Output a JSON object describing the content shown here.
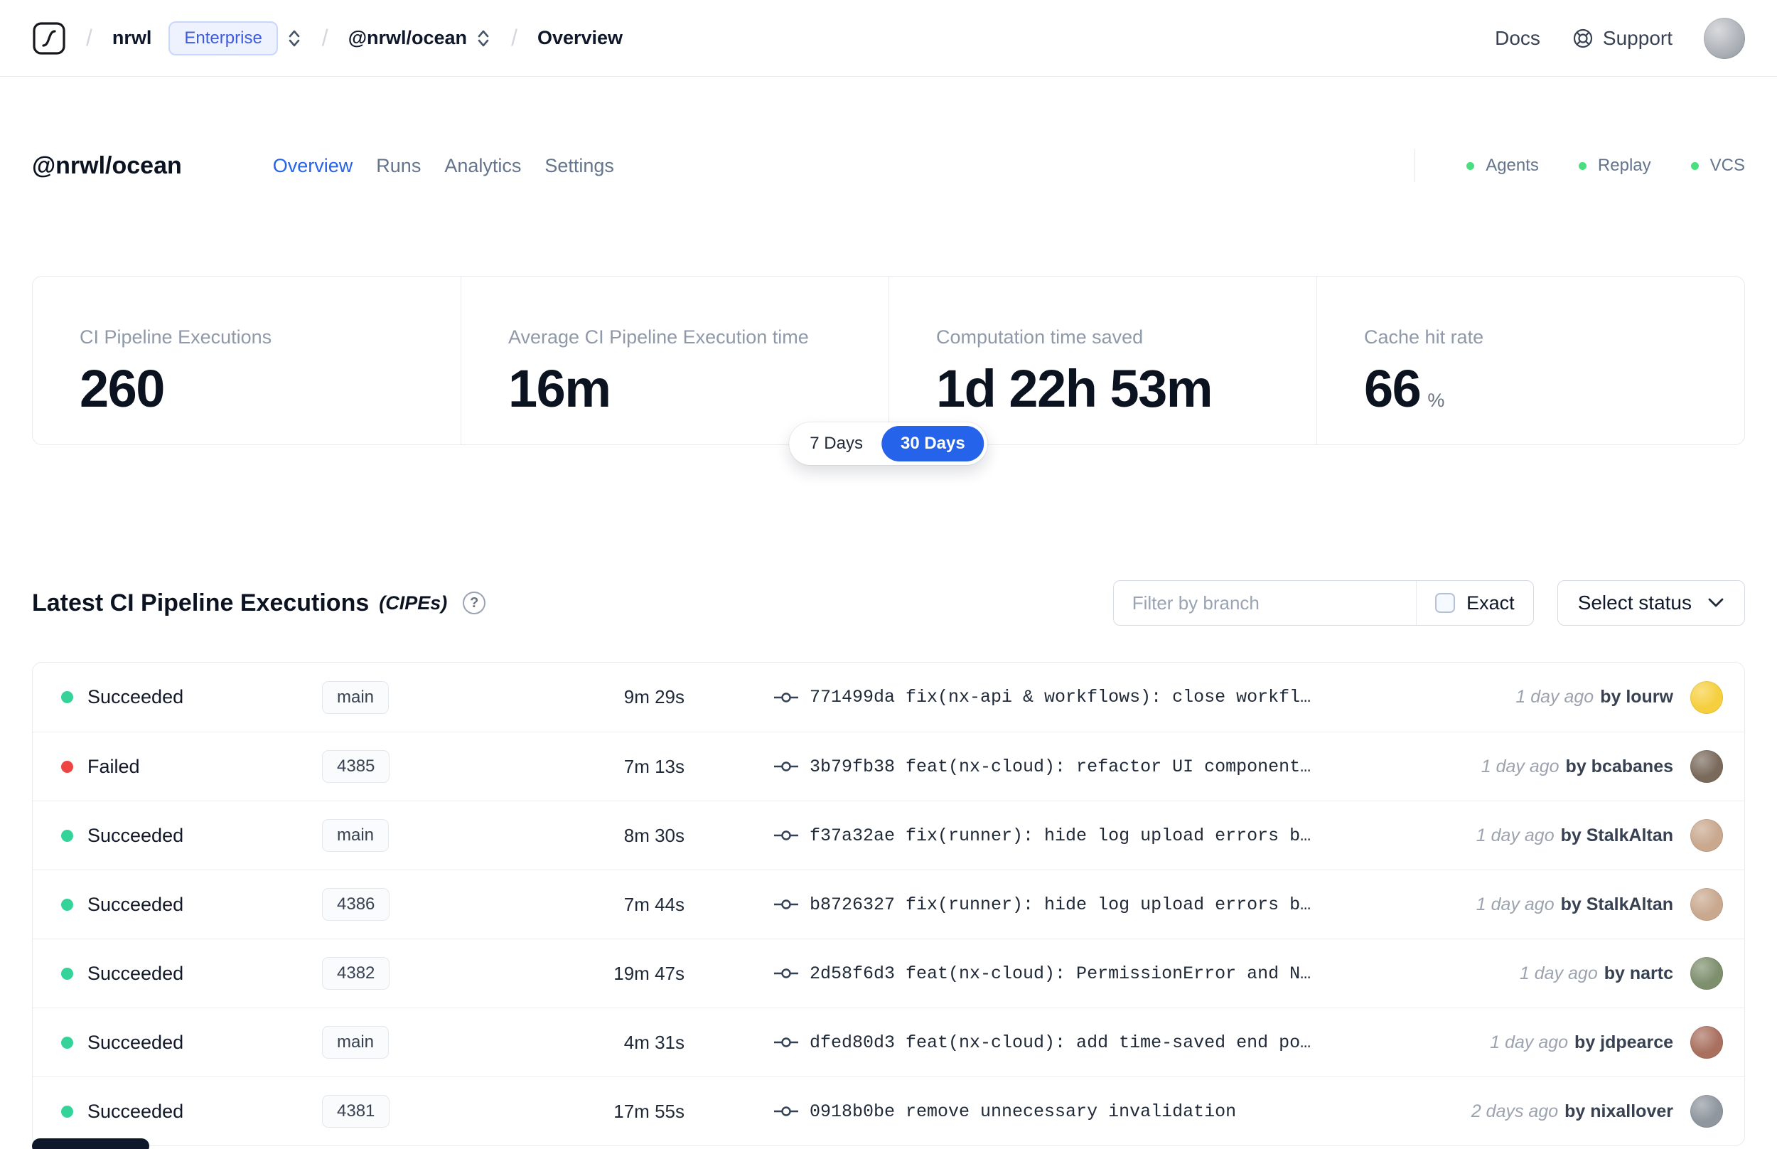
{
  "colors": {
    "accent": "#2563eb",
    "success": "#34d399",
    "error": "#ef4444"
  },
  "topbar": {
    "sep": "/",
    "org": "nrwl",
    "org_badge": "Enterprise",
    "workspace": "@nrwl/ocean",
    "page": "Overview",
    "docs": "Docs",
    "support": "Support"
  },
  "workspace": {
    "title": "@nrwl/ocean",
    "tabs": [
      {
        "label": "Overview",
        "active": true
      },
      {
        "label": "Runs",
        "active": false
      },
      {
        "label": "Analytics",
        "active": false
      },
      {
        "label": "Settings",
        "active": false
      }
    ],
    "statuses": [
      {
        "label": "Agents"
      },
      {
        "label": "Replay"
      },
      {
        "label": "VCS"
      }
    ]
  },
  "stats": {
    "cards": [
      {
        "label": "CI Pipeline Executions",
        "value": "260"
      },
      {
        "label": "Average CI Pipeline Execution time",
        "value": "16m"
      },
      {
        "label": "Computation time saved",
        "value": "1d 22h 53m"
      },
      {
        "label": "Cache hit rate",
        "value": "66",
        "suffix": "%"
      }
    ],
    "range": {
      "options": [
        {
          "label": "7 Days",
          "active": false
        },
        {
          "label": "30 Days",
          "active": true
        }
      ]
    }
  },
  "cipes": {
    "title": "Latest CI Pipeline Executions",
    "subtitle": "(CIPEs)",
    "help_glyph": "?",
    "filter_placeholder": "Filter by branch",
    "exact_label": "Exact",
    "status_dropdown_label": "Select status",
    "rows": [
      {
        "status": "Succeeded",
        "status_color": "#34d399",
        "branch": "main",
        "duration": "9m 29s",
        "commit": "771499da fix(nx-api & workflows): close workfl…",
        "time": "1 day ago",
        "author": "by lourw",
        "avatar_color": "#f6cf3e"
      },
      {
        "status": "Failed",
        "status_color": "#ef4444",
        "branch": "4385",
        "duration": "7m 13s",
        "commit": "3b79fb38 feat(nx-cloud): refactor UI component…",
        "time": "1 day ago",
        "author": "by bcabanes",
        "avatar_color": "#7a6a5c"
      },
      {
        "status": "Succeeded",
        "status_color": "#34d399",
        "branch": "main",
        "duration": "8m 30s",
        "commit": "f37a32ae fix(runner): hide log upload errors b…",
        "time": "1 day ago",
        "author": "by StalkAltan",
        "avatar_color": "#c9a88e"
      },
      {
        "status": "Succeeded",
        "status_color": "#34d399",
        "branch": "4386",
        "duration": "7m 44s",
        "commit": "b8726327 fix(runner): hide log upload errors b…",
        "time": "1 day ago",
        "author": "by StalkAltan",
        "avatar_color": "#c9a88e"
      },
      {
        "status": "Succeeded",
        "status_color": "#34d399",
        "branch": "4382",
        "duration": "19m 47s",
        "commit": "2d58f6d3 feat(nx-cloud): PermissionError and N…",
        "time": "1 day ago",
        "author": "by nartc",
        "avatar_color": "#7d8f6d"
      },
      {
        "status": "Succeeded",
        "status_color": "#34d399",
        "branch": "main",
        "duration": "4m 31s",
        "commit": "dfed80d3 feat(nx-cloud): add time-saved end po…",
        "time": "1 day ago",
        "author": "by jdpearce",
        "avatar_color": "#a9705f"
      },
      {
        "status": "Succeeded",
        "status_color": "#34d399",
        "branch": "4381",
        "duration": "17m 55s",
        "commit": "0918b0be remove unnecessary invalidation",
        "time": "2 days ago",
        "author": "by nixallover",
        "avatar_color": "#8f969e"
      }
    ]
  }
}
